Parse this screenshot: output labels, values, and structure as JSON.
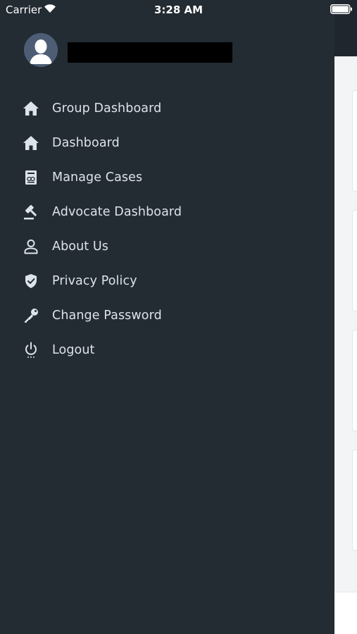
{
  "status_bar": {
    "carrier": "Carrier",
    "time": "3:28 AM"
  },
  "colors": {
    "drawer_bg": "#232b33",
    "text": "#dde3ea",
    "icon": "#dde3ea",
    "avatar_bg": "#4d5d75"
  },
  "profile": {
    "avatar_icon": "user-avatar-icon",
    "name": ""
  },
  "menu": {
    "items": [
      {
        "label": "Group Dashboard",
        "icon": "home-icon"
      },
      {
        "label": "Dashboard",
        "icon": "home-icon"
      },
      {
        "label": "Manage Cases",
        "icon": "case-document-icon"
      },
      {
        "label": "Advocate Dashboard",
        "icon": "gavel-icon"
      },
      {
        "label": "About Us",
        "icon": "person-icon"
      },
      {
        "label": "Privacy Policy",
        "icon": "shield-check-icon"
      },
      {
        "label": "Change Password",
        "icon": "key-icon"
      },
      {
        "label": "Logout",
        "icon": "power-icon"
      }
    ]
  }
}
